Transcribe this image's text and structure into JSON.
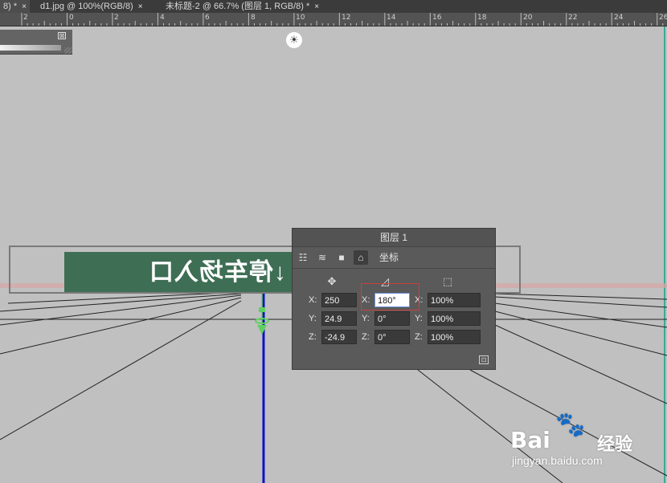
{
  "tabs": [
    {
      "label": "8) *",
      "active": true
    },
    {
      "label": "d1.jpg @ 100%(RGB/8)",
      "active": false
    },
    {
      "label": "未标题-2 @ 66.7% (图层 1, RGB/8) *",
      "active": false
    }
  ],
  "tab_close_glyph": "×",
  "ruler": {
    "labels": [
      "2",
      "0",
      "2",
      "4",
      "6",
      "8",
      "10",
      "12",
      "14",
      "16",
      "18",
      "20",
      "22",
      "24",
      "26"
    ]
  },
  "banner": {
    "text": "↓停车场入口"
  },
  "properties_panel": {
    "title": "图层 1",
    "toolbar_icons": [
      "layer-filter-icon",
      "mesh-icon",
      "camera-icon",
      "coordinates-icon"
    ],
    "mode_label": "坐标",
    "columns": {
      "position_icon": "move-icon",
      "rotation_icon": "rotate-icon",
      "scale_icon": "scale-icon"
    },
    "rows": [
      {
        "label": "X:",
        "position": "250",
        "rotation_label": "X:",
        "rotation": "180°",
        "scale_label": "X:",
        "scale": "100%"
      },
      {
        "label": "Y:",
        "position": "24.9",
        "rotation_label": "Y:",
        "rotation": "0°",
        "scale_label": "Y:",
        "scale": "100%"
      },
      {
        "label": "Z:",
        "position": "-24.9",
        "rotation_label": "Z:",
        "rotation": "0°",
        "scale_label": "Z:",
        "scale": "100%"
      }
    ]
  },
  "watermark": {
    "logo": "Bai",
    "logo_suffix": "经验",
    "url": "jingyan.baidu.com"
  },
  "colors": {
    "canvas": "#c0c0c0",
    "panel": "#5a5a5a",
    "banner_green": "#3e6e54",
    "highlight": "#c94040",
    "axis_blue": "#1010c8",
    "axis_green": "#60d060"
  }
}
